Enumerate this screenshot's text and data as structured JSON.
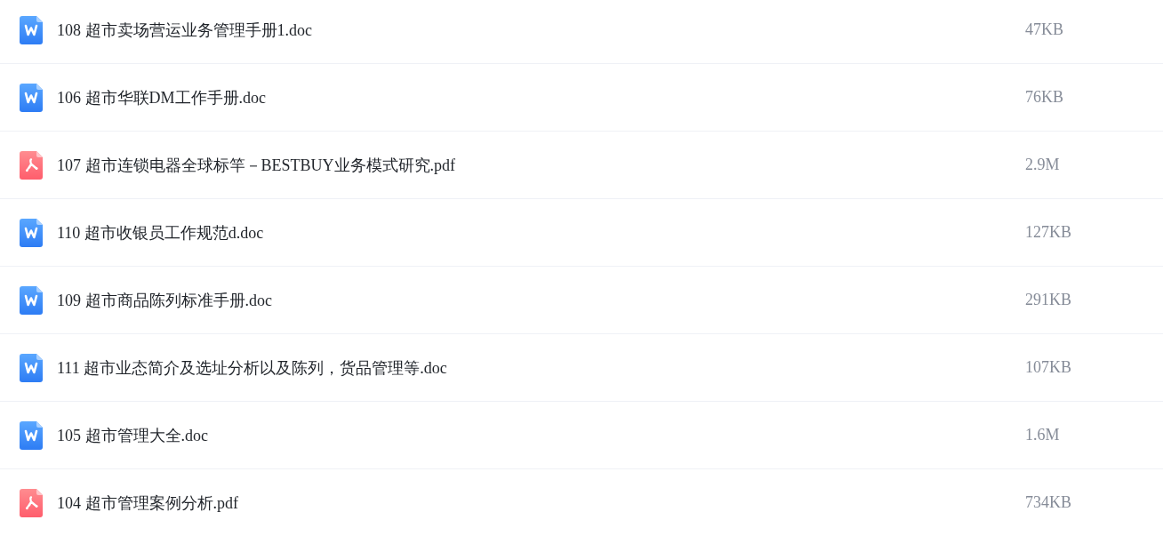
{
  "files": [
    {
      "kind": "doc",
      "name": "108 超市卖场营运业务管理手册1.doc",
      "size": "47KB"
    },
    {
      "kind": "doc",
      "name": "106 超市华联DM工作手册.doc",
      "size": "76KB"
    },
    {
      "kind": "pdf",
      "name": "107 超市连锁电器全球标竿－BESTBUY业务模式研究.pdf",
      "size": "2.9M"
    },
    {
      "kind": "doc",
      "name": "110 超市收银员工作规范d.doc",
      "size": "127KB"
    },
    {
      "kind": "doc",
      "name": "109 超市商品陈列标准手册.doc",
      "size": "291KB"
    },
    {
      "kind": "doc",
      "name": "111 超市业态简介及选址分析以及陈列，货品管理等.doc",
      "size": "107KB"
    },
    {
      "kind": "doc",
      "name": "105 超市管理大全.doc",
      "size": "1.6M"
    },
    {
      "kind": "pdf",
      "name": "104 超市管理案例分析.pdf",
      "size": "734KB"
    }
  ]
}
